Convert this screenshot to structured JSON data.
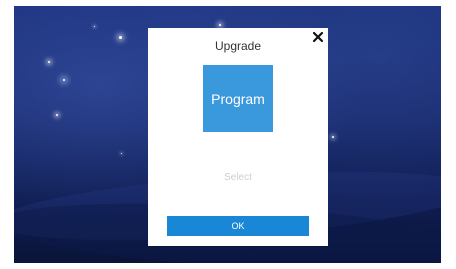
{
  "dialog": {
    "title": "Upgrade",
    "close_icon": "close-icon",
    "tile_label": "Program",
    "select_text": "Select",
    "ok_label": "OK"
  },
  "colors": {
    "background_blue": "#17286a",
    "tile_blue": "#3a98dc",
    "ok_button_blue": "#1a87d6",
    "dialog_bg": "#ffffff",
    "select_text_gray": "#cfcfcf"
  }
}
